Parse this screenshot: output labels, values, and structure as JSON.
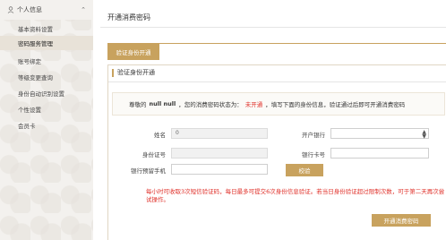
{
  "sidebar": {
    "header": "个人信息",
    "items": [
      {
        "label": "基本资料设置",
        "active": false
      },
      {
        "label": "密码服务管理",
        "active": true
      },
      {
        "label": "账号绑定",
        "active": false
      },
      {
        "label": "等级变更查询",
        "active": false
      },
      {
        "label": "身份自动识别设置",
        "active": false
      },
      {
        "label": "个性设置",
        "active": false
      },
      {
        "label": "会员卡",
        "active": false
      }
    ]
  },
  "main": {
    "page_title": "开通消费密码",
    "tab_label": "验证身份开通",
    "section_title": "验证身份开通",
    "notice": {
      "prefix": "尊敬的",
      "name": "null null",
      "middle": "，您的消费密码状态为：",
      "status": "未开通",
      "suffix": "，填写下面的身份信息，验证通过后即可开通消费密码"
    },
    "form": {
      "name_label": "姓名",
      "name_value": "0",
      "bank_label": "开户银行",
      "id_label": "身份证号",
      "card_label": "银行卡号",
      "phone_label": "银行预留手机",
      "verify_button": "校验"
    },
    "warning": "每小时可收取3次短信验证码，每日最多可提交6次身份信息验证。若当日身份验证超过限制次数，可于第二天再次尝试操作。",
    "open_button": "开通消费密码"
  },
  "colors": {
    "accent": "#c8a25e",
    "error": "#e0312a",
    "sidebar_bg": "#f3f1ee"
  }
}
